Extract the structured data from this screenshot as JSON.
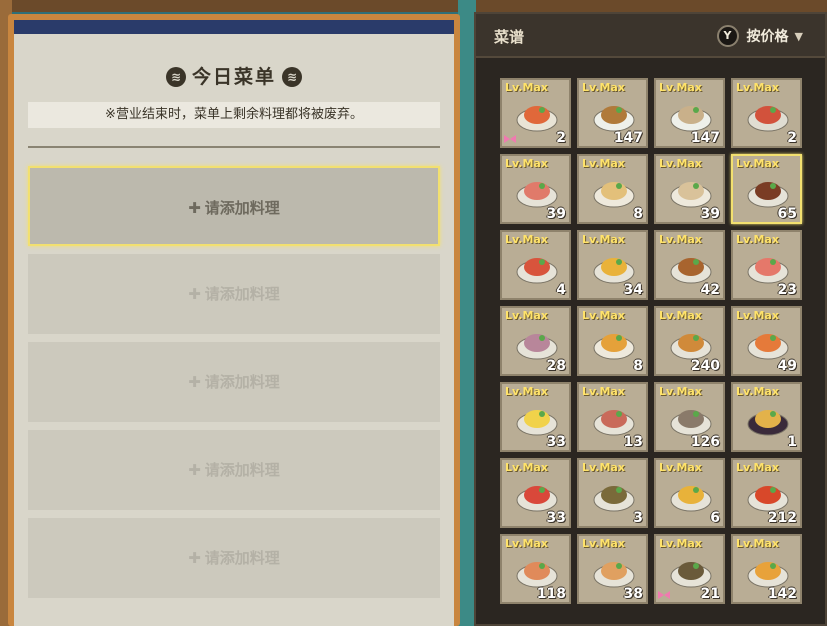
{
  "menu": {
    "title": "今日菜单",
    "notice": "※营业结束时，菜单上剩余料理都将被废弃。",
    "add_label": "请添加料理",
    "slots": [
      {
        "active": true
      },
      {
        "active": false
      },
      {
        "active": false
      },
      {
        "active": false
      },
      {
        "active": false
      }
    ]
  },
  "recipes": {
    "title": "菜谱",
    "sort_key": "Y",
    "sort_label": "按价格",
    "level_label": "Lv.Max",
    "items": [
      {
        "count": "2",
        "plate": "#e9e4d6",
        "food": "#e0683a",
        "tag": true,
        "selected": false
      },
      {
        "count": "147",
        "plate": "#eef0ea",
        "food": "#b07a3a",
        "tag": false,
        "selected": false
      },
      {
        "count": "147",
        "plate": "#eef0ea",
        "food": "#c9b08a",
        "tag": false,
        "selected": false
      },
      {
        "count": "2",
        "plate": "#e0ddd2",
        "food": "#d2523c",
        "tag": false,
        "selected": false
      },
      {
        "count": "39",
        "plate": "#e6e3d8",
        "food": "#e07a6a",
        "tag": false,
        "selected": false
      },
      {
        "count": "8",
        "plate": "#eee9dc",
        "food": "#e3c07a",
        "tag": false,
        "selected": false
      },
      {
        "count": "39",
        "plate": "#eee9dc",
        "food": "#d9c29a",
        "tag": false,
        "selected": false
      },
      {
        "count": "65",
        "plate": "#e6e3d8",
        "food": "#7a3c24",
        "tag": false,
        "selected": true
      },
      {
        "count": "4",
        "plate": "#e6e3d8",
        "food": "#d8543c",
        "tag": false,
        "selected": false
      },
      {
        "count": "34",
        "plate": "#e6e3d8",
        "food": "#e9b23a",
        "tag": false,
        "selected": false
      },
      {
        "count": "42",
        "plate": "#e6e3d8",
        "food": "#a8642e",
        "tag": false,
        "selected": false
      },
      {
        "count": "23",
        "plate": "#e6e3d8",
        "food": "#e5786a",
        "tag": false,
        "selected": false
      },
      {
        "count": "28",
        "plate": "#e6e3d8",
        "food": "#b8869a",
        "tag": false,
        "selected": false
      },
      {
        "count": "8",
        "plate": "#eee9dc",
        "food": "#e5a13a",
        "tag": false,
        "selected": false
      },
      {
        "count": "240",
        "plate": "#e6e3d8",
        "food": "#d08a3a",
        "tag": false,
        "selected": false
      },
      {
        "count": "49",
        "plate": "#e6e3d8",
        "food": "#e57a3a",
        "tag": false,
        "selected": false
      },
      {
        "count": "33",
        "plate": "#e6e3d8",
        "food": "#f1d24a",
        "tag": false,
        "selected": false
      },
      {
        "count": "13",
        "plate": "#e6e3d8",
        "food": "#c96a5a",
        "tag": false,
        "selected": false
      },
      {
        "count": "126",
        "plate": "#e6e3d8",
        "food": "#8a7a6a",
        "tag": false,
        "selected": false
      },
      {
        "count": "1",
        "plate": "#3a2a3a",
        "food": "#e3b24a",
        "tag": false,
        "selected": false
      },
      {
        "count": "33",
        "plate": "#e6e3d8",
        "food": "#d9483a",
        "tag": false,
        "selected": false
      },
      {
        "count": "3",
        "plate": "#e6e3d8",
        "food": "#7a6a3a",
        "tag": false,
        "selected": false
      },
      {
        "count": "6",
        "plate": "#e6e3d8",
        "food": "#e8b23a",
        "tag": false,
        "selected": false
      },
      {
        "count": "212",
        "plate": "#e6e3d8",
        "food": "#d8482a",
        "tag": false,
        "selected": false
      },
      {
        "count": "118",
        "plate": "#e6e3d8",
        "food": "#e08a5a",
        "tag": false,
        "selected": false
      },
      {
        "count": "38",
        "plate": "#e6e3d8",
        "food": "#e0a060",
        "tag": false,
        "selected": false
      },
      {
        "count": "21",
        "plate": "#e6e3d8",
        "food": "#6a5a3a",
        "tag": true,
        "selected": false
      },
      {
        "count": "142",
        "plate": "#e6e3d8",
        "food": "#e8a23a",
        "tag": false,
        "selected": false
      }
    ]
  },
  "colors": {
    "highlight": "#f2e070",
    "level_text": "#ffe36a",
    "tag": "#f07ab0"
  }
}
